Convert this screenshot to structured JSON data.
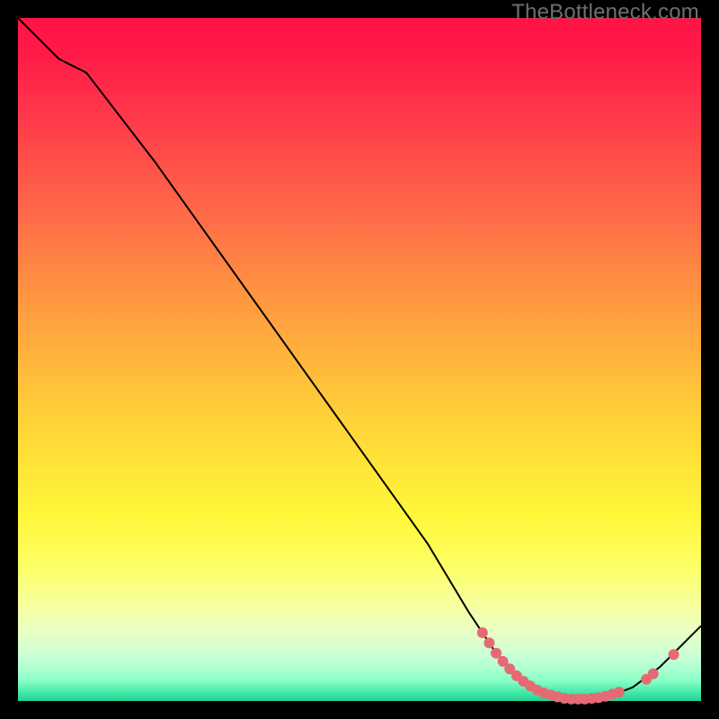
{
  "watermark": "TheBottleneck.com",
  "colors": {
    "background": "#000000",
    "curve": "#000000",
    "dots": "#e66a74"
  },
  "chart_data": {
    "type": "line",
    "title": "",
    "xlabel": "",
    "ylabel": "",
    "xlim": [
      0,
      100
    ],
    "ylim": [
      0,
      100
    ],
    "grid": false,
    "curve_points": [
      {
        "x": 0,
        "y": 100
      },
      {
        "x": 6,
        "y": 94
      },
      {
        "x": 10,
        "y": 92
      },
      {
        "x": 20,
        "y": 79
      },
      {
        "x": 30,
        "y": 65
      },
      {
        "x": 40,
        "y": 51
      },
      {
        "x": 50,
        "y": 37
      },
      {
        "x": 60,
        "y": 23
      },
      {
        "x": 66,
        "y": 13
      },
      {
        "x": 70,
        "y": 7
      },
      {
        "x": 74,
        "y": 3
      },
      {
        "x": 78,
        "y": 1
      },
      {
        "x": 82,
        "y": 0.3
      },
      {
        "x": 86,
        "y": 0.5
      },
      {
        "x": 90,
        "y": 2
      },
      {
        "x": 94,
        "y": 5
      },
      {
        "x": 98,
        "y": 9
      },
      {
        "x": 100,
        "y": 11
      }
    ],
    "scatter_points": [
      {
        "x": 68,
        "y": 10.0
      },
      {
        "x": 69,
        "y": 8.5
      },
      {
        "x": 70,
        "y": 7.0
      },
      {
        "x": 71,
        "y": 5.8
      },
      {
        "x": 72,
        "y": 4.7
      },
      {
        "x": 73,
        "y": 3.7
      },
      {
        "x": 74,
        "y": 2.9
      },
      {
        "x": 75,
        "y": 2.2
      },
      {
        "x": 76,
        "y": 1.6
      },
      {
        "x": 77,
        "y": 1.2
      },
      {
        "x": 78,
        "y": 0.9
      },
      {
        "x": 79,
        "y": 0.6
      },
      {
        "x": 80,
        "y": 0.4
      },
      {
        "x": 81,
        "y": 0.3
      },
      {
        "x": 82,
        "y": 0.3
      },
      {
        "x": 83,
        "y": 0.3
      },
      {
        "x": 84,
        "y": 0.4
      },
      {
        "x": 85,
        "y": 0.5
      },
      {
        "x": 86,
        "y": 0.7
      },
      {
        "x": 87,
        "y": 1.0
      },
      {
        "x": 88,
        "y": 1.3
      },
      {
        "x": 92,
        "y": 3.2
      },
      {
        "x": 93,
        "y": 4.0
      },
      {
        "x": 96,
        "y": 6.8
      }
    ]
  }
}
